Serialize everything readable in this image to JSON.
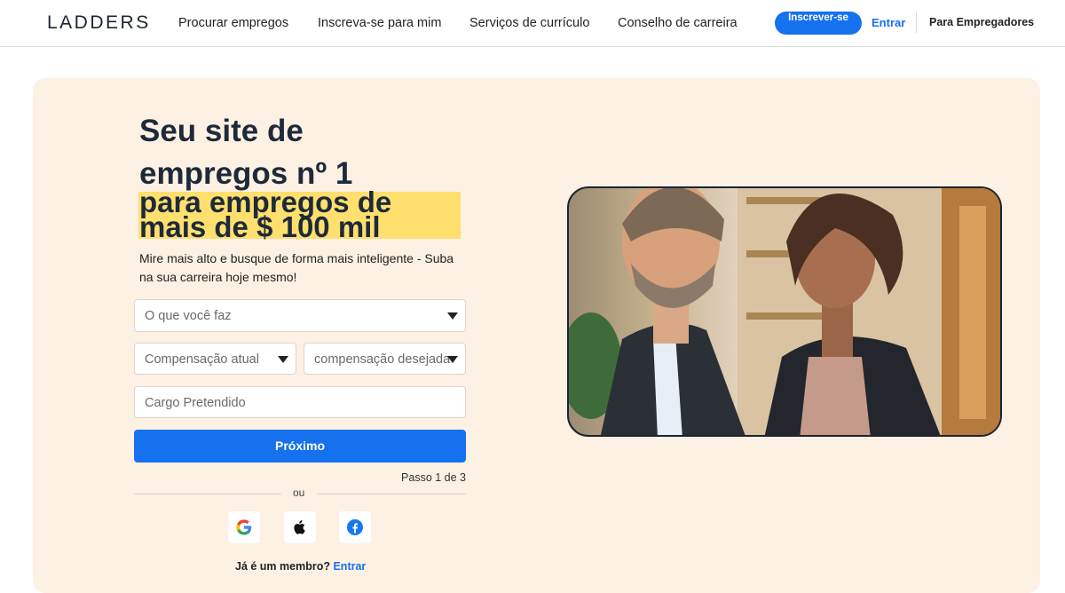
{
  "header": {
    "logo": "LADDERS",
    "nav": [
      "Procurar empregos",
      "Inscreva-se para mim",
      "Serviços de currículo",
      "Conselho de carreira"
    ],
    "signup_label": "Inscrever-se",
    "signin_label": "Entrar",
    "employers_label": "Para Empregadores"
  },
  "hero": {
    "headline_line1": "Seu site de",
    "headline_line2": "empregos nº 1",
    "highlight_line1": "para empregos de",
    "highlight_line2": "mais de $ 100 mil",
    "subtext": "Mire mais alto e busque de forma mais inteligente - Suba na sua carreira hoje mesmo!"
  },
  "form": {
    "job_select_placeholder": "O que você faz",
    "current_comp_placeholder": "Compensação atual",
    "desired_comp_placeholder": "compensação desejada",
    "target_title_placeholder": "Cargo Pretendido",
    "next_label": "Próximo",
    "step_text": "Passo 1 de 3",
    "or_text": "ou",
    "member_text": "Já é um membro?",
    "member_link": "Entrar"
  },
  "social": [
    "google-icon",
    "apple-icon",
    "facebook-icon"
  ],
  "colors": {
    "accent": "#1671ef",
    "hero_bg": "#fdf1e3",
    "highlight": "#ffdf6e",
    "headline": "#1e2a3a"
  }
}
